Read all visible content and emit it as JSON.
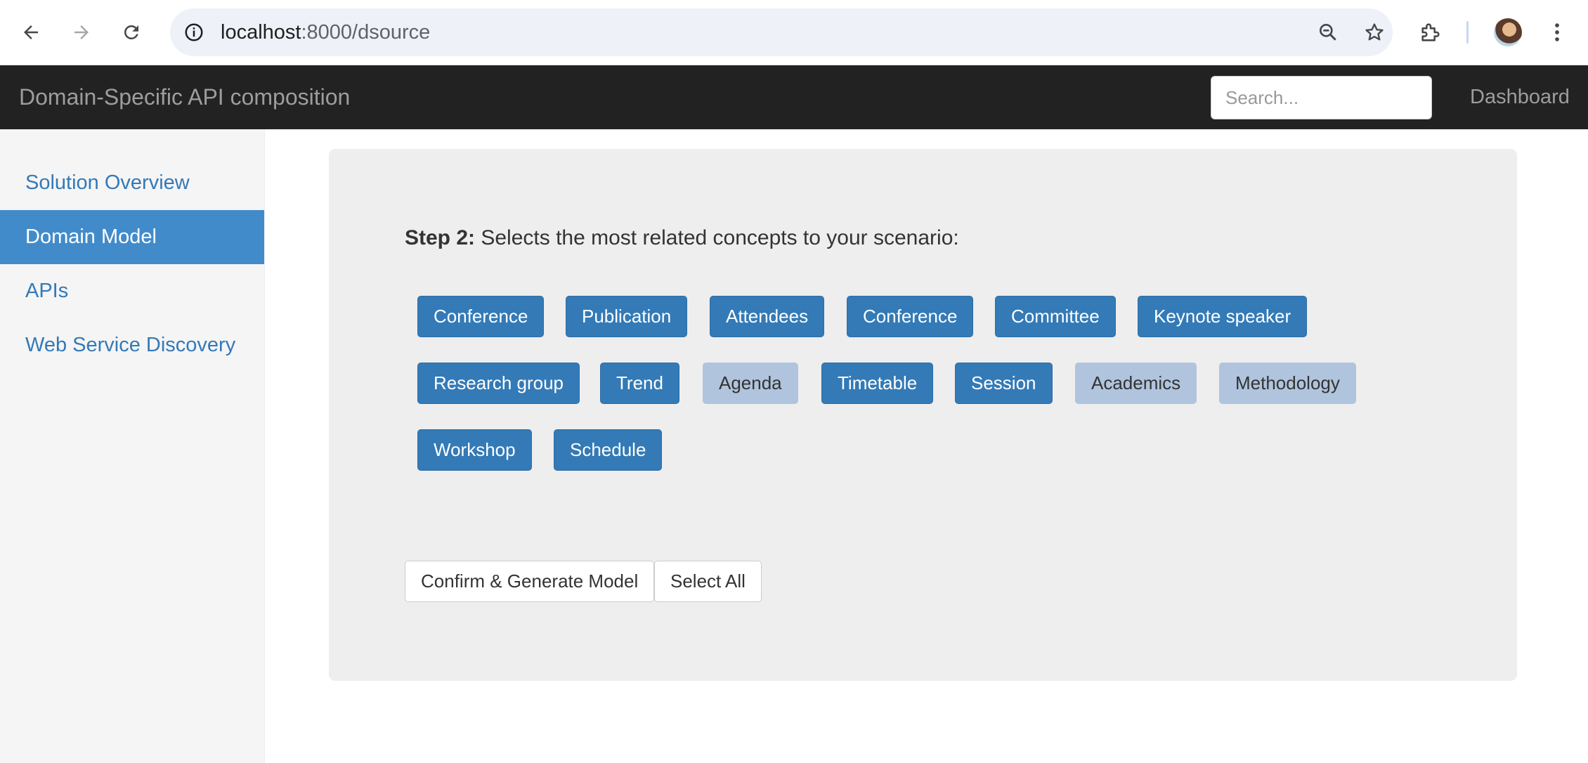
{
  "browser": {
    "url_host": "localhost",
    "url_path": ":8000/dsource"
  },
  "navbar": {
    "brand": "Domain-Specific API composition",
    "search_placeholder": "Search...",
    "dashboard": "Dashboard"
  },
  "sidebar": {
    "items": [
      {
        "label": "Solution Overview",
        "active": false
      },
      {
        "label": "Domain Model",
        "active": true
      },
      {
        "label": "APIs",
        "active": false
      },
      {
        "label": "Web Service Discovery",
        "active": false
      }
    ]
  },
  "main": {
    "step_label": "Step 2:",
    "step_text": " Selects the most related concepts to your scenario:",
    "concepts": [
      {
        "label": "Conference",
        "selected": true
      },
      {
        "label": "Publication",
        "selected": true
      },
      {
        "label": "Attendees",
        "selected": true
      },
      {
        "label": "Conference",
        "selected": true
      },
      {
        "label": "Committee",
        "selected": true
      },
      {
        "label": "Keynote speaker",
        "selected": true
      },
      {
        "label": "Research group",
        "selected": true
      },
      {
        "label": "Trend",
        "selected": true
      },
      {
        "label": "Agenda",
        "selected": false
      },
      {
        "label": "Timetable",
        "selected": true
      },
      {
        "label": "Session",
        "selected": true
      },
      {
        "label": "Academics",
        "selected": false
      },
      {
        "label": "Methodology",
        "selected": false
      },
      {
        "label": "Workshop",
        "selected": true
      },
      {
        "label": "Schedule",
        "selected": true
      }
    ],
    "confirm_button": "Confirm & Generate Model",
    "select_all_button": "Select All"
  },
  "colors": {
    "selected_concept": "#337ab7",
    "unselected_concept": "#b0c4de",
    "sidebar_active": "#428bca",
    "navbar_bg": "#222222"
  }
}
